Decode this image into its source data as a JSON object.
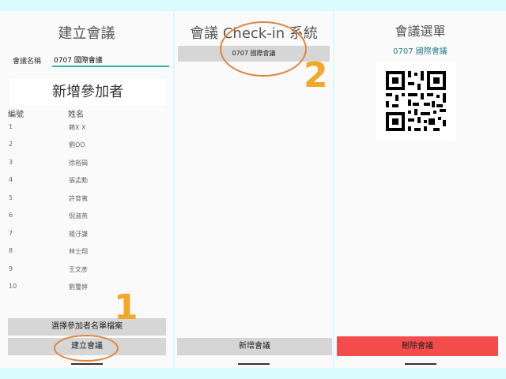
{
  "panel1": {
    "title": "建立會議",
    "meeting_name_label": "會議名稱",
    "meeting_name_value": "0707 國際會議",
    "add_participants_header": "新增參加者",
    "columns": {
      "number": "編號",
      "name": "姓名"
    },
    "participants": [
      {
        "no": "1",
        "name": "賴X X"
      },
      {
        "no": "2",
        "name": "劉OO"
      },
      {
        "no": "3",
        "name": "徐裕碣"
      },
      {
        "no": "4",
        "name": "張孟勳"
      },
      {
        "no": "5",
        "name": "許育寬"
      },
      {
        "no": "6",
        "name": "倪淑燕"
      },
      {
        "no": "7",
        "name": "楊汙謙"
      },
      {
        "no": "8",
        "name": "林士翔"
      },
      {
        "no": "9",
        "name": "王文彥"
      },
      {
        "no": "10",
        "name": "劉璽婷"
      }
    ],
    "select_file_button": "選擇參加者名單檔案",
    "create_button": "建立會議"
  },
  "panel2": {
    "title": "會議 Check-in 系統",
    "meeting_item": "0707 國際會議",
    "add_meeting_button": "新增會議"
  },
  "panel3": {
    "title": "會議選單",
    "meeting_name": "0707 國際會議",
    "delete_button": "刪除會議"
  },
  "annotations": {
    "step1": "1",
    "step2": "2"
  },
  "colors": {
    "background": "#d9fbfd",
    "accent": "#2ab7a9",
    "delete": "#f44b4b",
    "annotation": "#f4a72a",
    "ellipse": "#e0853d"
  },
  "icons": [
    "qr-code-icon"
  ]
}
